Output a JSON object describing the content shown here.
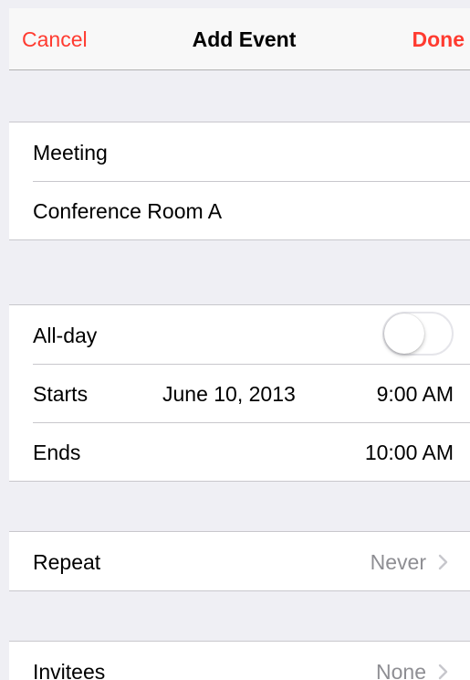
{
  "navbar": {
    "cancel_label": "Cancel",
    "title": "Add Event",
    "done_label": "Done"
  },
  "event": {
    "title": "Meeting",
    "location": "Conference Room A"
  },
  "schedule": {
    "allday_label": "All-day",
    "allday_on": false,
    "starts_label": "Starts",
    "starts_date": "June 10, 2013",
    "starts_time": "9:00 AM",
    "ends_label": "Ends",
    "ends_time": "10:00 AM"
  },
  "repeat": {
    "label": "Repeat",
    "value": "Never"
  },
  "invitees": {
    "label": "Invitees",
    "value": "None"
  },
  "colors": {
    "accent": "#ff3b30",
    "background": "#efeff4",
    "detail_text": "#8e8e93",
    "separator": "#c8c7cc"
  }
}
